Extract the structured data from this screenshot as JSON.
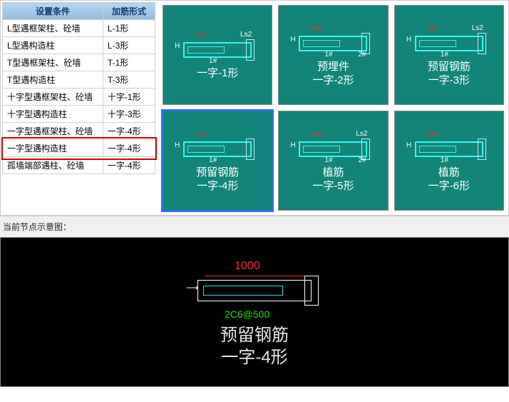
{
  "table": {
    "headers": [
      "设置条件",
      "加筋形式"
    ],
    "rows": [
      {
        "c1": "L型遇框架柱、砼墙",
        "c2": "L-1形"
      },
      {
        "c1": "L型遇构造柱",
        "c2": "L-3形"
      },
      {
        "c1": "T型遇框架柱、砼墙",
        "c2": "T-1形"
      },
      {
        "c1": "T型遇构造柱",
        "c2": "T-3形"
      },
      {
        "c1": "十字型遇框架柱、砼墙",
        "c2": "十字-1形"
      },
      {
        "c1": "十字型遇构造柱",
        "c2": "十字-3形"
      },
      {
        "c1": "一字型遇框架柱、砼墙",
        "c2": "一字-4形"
      },
      {
        "c1": "一字型遇构造柱",
        "c2": "一字-4形"
      },
      {
        "c1": "孤墙端部遇柱、砼墙",
        "c2": "一字-4形"
      }
    ]
  },
  "thumbs": [
    {
      "line1": "",
      "line2": "一字-1形",
      "dim1": "Ls1",
      "dim2": "Ls2",
      "tag1": "1#",
      "tag2": "",
      "h": "H"
    },
    {
      "line1": "预埋件",
      "line2": "一字-2形",
      "dim1": "Ls1",
      "dim2": "",
      "tag1": "1#",
      "tag2": "2#",
      "h": "H"
    },
    {
      "line1": "预留钢筋",
      "line2": "一字-3形",
      "dim1": "Ls1",
      "dim2": "Ls2",
      "tag1": "1#",
      "tag2": "",
      "h": "H"
    },
    {
      "line1": "预留钢筋",
      "line2": "一字-4形",
      "dim1": "Ls1",
      "dim2": "",
      "tag1": "1#",
      "tag2": "",
      "h": "H",
      "selected": true
    },
    {
      "line1": "植筋",
      "line2": "一字-5形",
      "dim1": "Ls1",
      "dim2": "Ls2",
      "tag1": "1#",
      "tag2": "2#",
      "h": "H"
    },
    {
      "line1": "植筋",
      "line2": "一字-6形",
      "dim1": "Ls1",
      "dim2": "",
      "tag1": "1#",
      "tag2": "",
      "h": "H"
    }
  ],
  "highlighted_row_index": 7,
  "preview_header": "当前节点示意图：",
  "preview": {
    "line1": "预留钢筋",
    "line2": "一字-4形",
    "dim_value": "1000",
    "spec": "2C6@500"
  }
}
